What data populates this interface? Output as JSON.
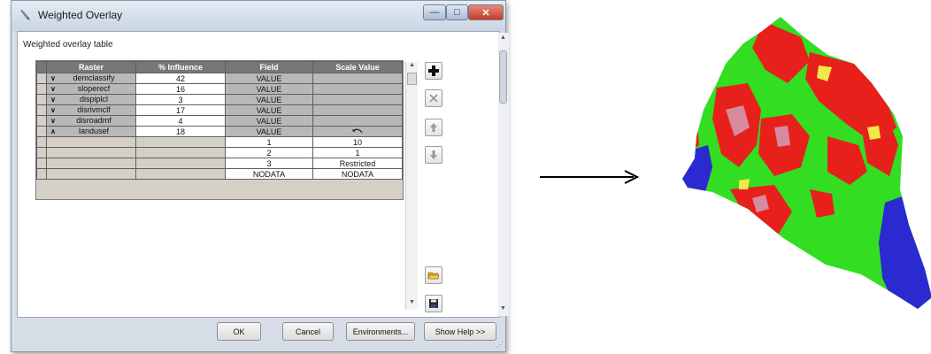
{
  "window": {
    "title": "Weighted Overlay"
  },
  "section_label": "Weighted overlay table",
  "table": {
    "headers": [
      "Raster",
      "% Influence",
      "Field",
      "Scale Value"
    ],
    "rows": [
      {
        "icon": "chevron-down-icon",
        "raster": "demclassify",
        "influence": "42",
        "field": "VALUE",
        "scale": ""
      },
      {
        "icon": "chevron-down-icon",
        "raster": "sloperecf",
        "influence": "16",
        "field": "VALUE",
        "scale": ""
      },
      {
        "icon": "chevron-down-icon",
        "raster": "dispiplcl",
        "influence": "3",
        "field": "VALUE",
        "scale": ""
      },
      {
        "icon": "chevron-down-icon",
        "raster": "disrivmclf",
        "influence": "17",
        "field": "VALUE",
        "scale": ""
      },
      {
        "icon": "chevron-down-icon",
        "raster": "disroadmf",
        "influence": "4",
        "field": "VALUE",
        "scale": ""
      },
      {
        "icon": "chevron-up-icon",
        "raster": "landusef",
        "influence": "18",
        "field": "VALUE",
        "scale": "undo-arrow-icon"
      }
    ],
    "sub_rows": [
      {
        "field": "1",
        "scale": "10"
      },
      {
        "field": "2",
        "scale": "1"
      },
      {
        "field": "3",
        "scale": "Restricted"
      },
      {
        "field": "NODATA",
        "scale": "NODATA"
      }
    ]
  },
  "side_tools": [
    "add-icon",
    "remove-icon",
    "move-up-icon",
    "move-down-icon",
    "open-folder-icon",
    "save-icon"
  ],
  "buttons": {
    "ok": "OK",
    "cancel": "Cancel",
    "environments": "Environments...",
    "help": "Show Help >>"
  },
  "colors": {
    "map_green": "#33dd22",
    "map_red": "#e8201c",
    "map_blue": "#2a2ad0",
    "map_pink": "#d68aa0"
  }
}
